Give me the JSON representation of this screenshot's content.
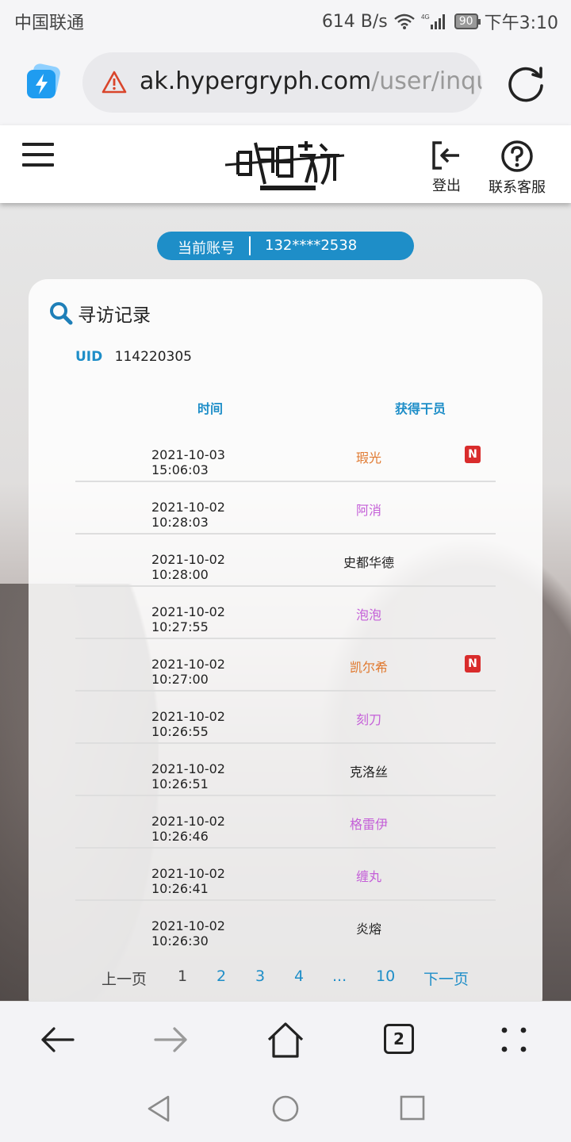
{
  "status_bar": {
    "carrier": "中国联通",
    "net_speed": "614 B/s",
    "battery": "90",
    "time": "下午3:10"
  },
  "browser": {
    "url_host": "ak.hypergryph.com",
    "url_path": "/user/inqu",
    "tab_count": "2"
  },
  "header": {
    "logout_label": "登出",
    "support_label": "联系客服"
  },
  "account": {
    "label": "当前账号",
    "value": "132****2538"
  },
  "card": {
    "title": "寻访记录",
    "uid_label": "UID",
    "uid_value": "114220305",
    "col_time": "时间",
    "col_operator": "获得干员",
    "rows": [
      {
        "time": "2021-10-03 15:06:03",
        "operator": "瑕光",
        "rarity": 6,
        "new": "N"
      },
      {
        "time": "2021-10-02 10:28:03",
        "operator": "阿消",
        "rarity": 5,
        "new": ""
      },
      {
        "time": "2021-10-02 10:28:00",
        "operator": "史都华德",
        "rarity": 4,
        "new": ""
      },
      {
        "time": "2021-10-02 10:27:55",
        "operator": "泡泡",
        "rarity": 5,
        "new": ""
      },
      {
        "time": "2021-10-02 10:27:00",
        "operator": "凯尔希",
        "rarity": 6,
        "new": "N"
      },
      {
        "time": "2021-10-02 10:26:55",
        "operator": "刻刀",
        "rarity": 5,
        "new": ""
      },
      {
        "time": "2021-10-02 10:26:51",
        "operator": "克洛丝",
        "rarity": 4,
        "new": ""
      },
      {
        "time": "2021-10-02 10:26:46",
        "operator": "格雷伊",
        "rarity": 5,
        "new": ""
      },
      {
        "time": "2021-10-02 10:26:41",
        "operator": "缠丸",
        "rarity": 5,
        "new": ""
      },
      {
        "time": "2021-10-02 10:26:30",
        "operator": "炎熔",
        "rarity": 4,
        "new": ""
      }
    ],
    "pagination": {
      "prev": "上一页",
      "current": "1",
      "pages": [
        "2",
        "3",
        "4",
        "...",
        "10"
      ],
      "next": "下一页"
    }
  },
  "colors": {
    "accent": "#1e8ec8",
    "six_star": "#e0782e",
    "five_star": "#c45fd8",
    "new_badge": "#d92c2c"
  }
}
